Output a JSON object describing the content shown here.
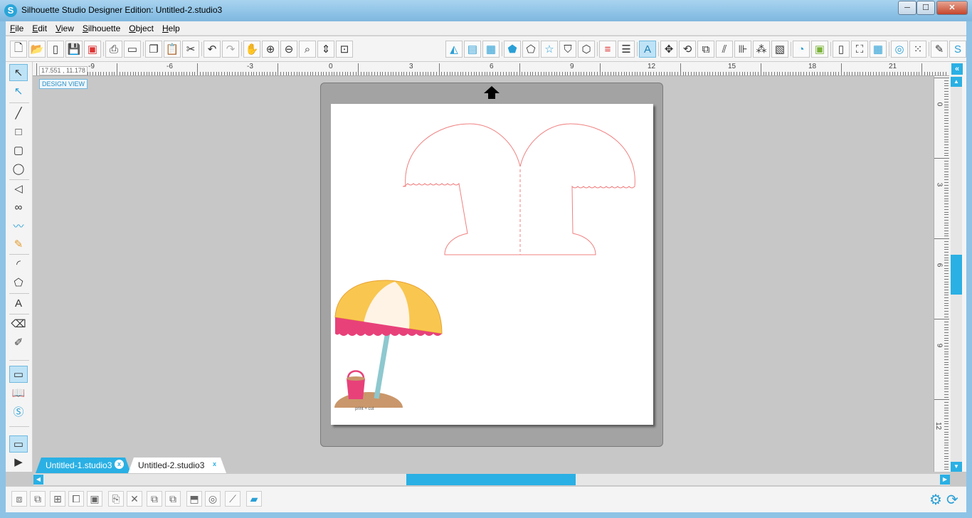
{
  "window": {
    "title": "Silhouette Studio Designer Edition: Untitled-2.studio3",
    "app_icon": "S",
    "minimize": "─",
    "maximize": "☐",
    "close": "✕"
  },
  "menu": [
    "File",
    "Edit",
    "View",
    "Silhouette",
    "Object",
    "Help"
  ],
  "toolbar": {
    "icons": [
      "new-document-icon",
      "open-icon",
      "open-library-icon",
      "save-icon",
      "save-to-library-icon",
      "print-icon",
      "send-to-cutter-icon",
      "copy-icon",
      "paste-icon",
      "cut-icon",
      "undo-icon",
      "redo-icon",
      "pan-icon",
      "zoom-in-icon",
      "zoom-out-icon",
      "zoom-selection-icon",
      "zoom-drag-icon",
      "fit-to-page-icon",
      "fill-color-icon",
      "fill-gradient-icon",
      "fill-pattern-icon",
      "line-color-icon",
      "line-style-icon",
      "shape-icon",
      "shape-star-icon",
      "shape-badge-icon",
      "line-color-swatch-icon",
      "line-width-icon",
      "text-style-icon",
      "transform-icon",
      "rotate-icon",
      "scale-icon",
      "shear-icon",
      "align-icon",
      "replicate-icon",
      "modify-icon",
      "offset-icon",
      "trace-icon",
      "page-setup-icon",
      "registration-marks-icon",
      "grid-icon",
      "cut-settings-icon",
      "rhinestone-icon",
      "sketch-icon",
      "library-panel-icon"
    ]
  },
  "coordinates": "17.551 , 11.178",
  "design_view_label": "DESIGN VIEW",
  "ruler": {
    "h_labels": [
      "-9",
      "-6",
      "-3",
      "0",
      "3",
      "6",
      "9",
      "12",
      "15",
      "18",
      "21"
    ],
    "v_labels": [
      "0",
      "3",
      "6",
      "9",
      "12"
    ]
  },
  "page": {
    "print_cut_label": "print + cut"
  },
  "tabs": [
    {
      "label": "Untitled-1.studio3",
      "close": "x",
      "active": false
    },
    {
      "label": "Untitled-2.studio3",
      "close": "x",
      "active": true
    }
  ],
  "colors": {
    "accent": "#2ab0e4",
    "cut_line": "#f08080",
    "umbrella_yellow": "#f9c74f",
    "umbrella_cream": "#fff3e6",
    "umbrella_pink": "#e8417a",
    "sand": "#c9976b",
    "pole": "#8ec8cf",
    "bucket": "#e8417a"
  },
  "collapse_label": "«"
}
